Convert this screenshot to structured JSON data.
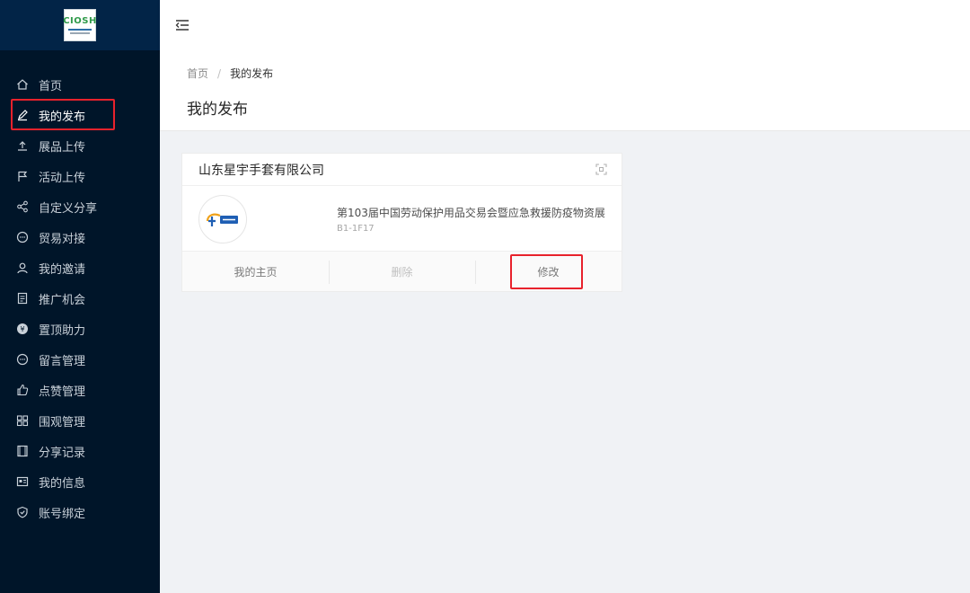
{
  "app": {
    "logo_text": "CIOSH"
  },
  "sidebar": {
    "items": [
      {
        "label": "首页",
        "icon": "home-icon"
      },
      {
        "label": "我的发布",
        "icon": "edit-icon",
        "active": true
      },
      {
        "label": "展品上传",
        "icon": "upload-icon"
      },
      {
        "label": "活动上传",
        "icon": "flag-icon"
      },
      {
        "label": "自定义分享",
        "icon": "share-icon"
      },
      {
        "label": "贸易对接",
        "icon": "message-icon"
      },
      {
        "label": "我的邀请",
        "icon": "user-icon"
      },
      {
        "label": "推广机会",
        "icon": "document-icon"
      },
      {
        "label": "置顶助力",
        "icon": "coin-icon"
      },
      {
        "label": "留言管理",
        "icon": "comment-icon"
      },
      {
        "label": "点赞管理",
        "icon": "like-icon"
      },
      {
        "label": "围观管理",
        "icon": "grid-icon"
      },
      {
        "label": "分享记录",
        "icon": "film-icon"
      },
      {
        "label": "我的信息",
        "icon": "profile-card-icon"
      },
      {
        "label": "账号绑定",
        "icon": "shield-check-icon"
      }
    ]
  },
  "breadcrumb": {
    "home": "首页",
    "separator": "/",
    "current": "我的发布"
  },
  "page": {
    "title": "我的发布"
  },
  "card": {
    "company": "山东星宇手套有限公司",
    "exhibition": "第103届中国劳动保护用品交易会暨应急救援防疫物资展",
    "booth": "B1-1F17",
    "actions": {
      "home": "我的主页",
      "delete": "删除",
      "edit": "修改"
    }
  },
  "colors": {
    "sidebar_bg": "#001529",
    "highlight": "#e8222c"
  }
}
